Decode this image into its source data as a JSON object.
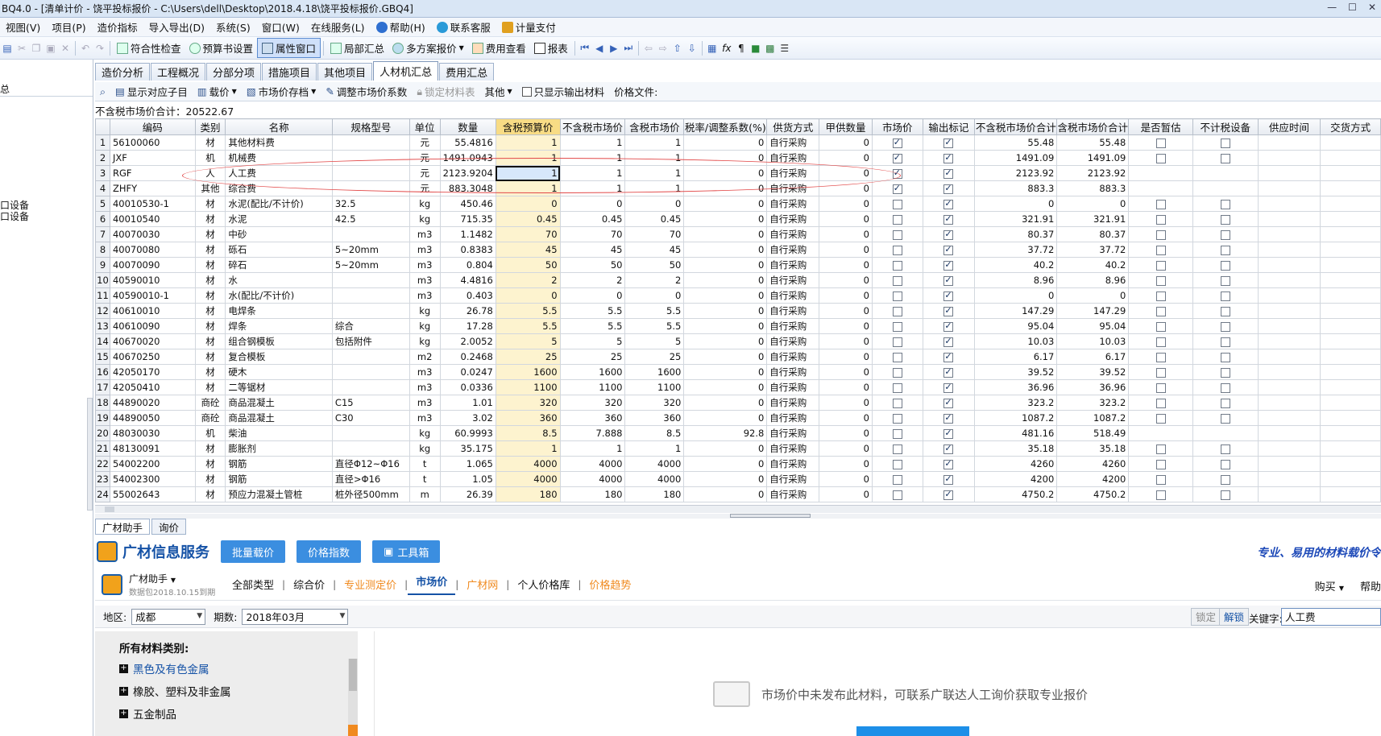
{
  "window": {
    "title": "BQ4.0 - [清单计价 - 饶平投标报价 - C:\\Users\\dell\\Desktop\\2018.4.18\\饶平投标报价.GBQ4]"
  },
  "menu": [
    "视图(V)",
    "项目(P)",
    "造价指标",
    "导入导出(D)",
    "系统(S)",
    "窗口(W)",
    "在线服务(L)",
    "帮助(H)",
    "联系客服",
    "计量支付"
  ],
  "toolbar": {
    "check": "符合性检查",
    "budget_settings": "预算书设置",
    "property_window": "属性窗口",
    "partial_summary": "局部汇总",
    "multi_plan": "多方案报价",
    "fee_view": "费用查看",
    "report": "报表"
  },
  "tabs": [
    "造价分析",
    "工程概况",
    "分部分项",
    "措施项目",
    "其他项目",
    "人材机汇总",
    "费用汇总"
  ],
  "subbar": {
    "show_sub": "显示对应子目",
    "load_price": "载价",
    "market_save": "市场价存档",
    "adjust_coef": "调整市场价系数",
    "lock_table": "锁定材料表",
    "other": "其他",
    "only_output": "只显示输出材料",
    "price_file": "价格文件:"
  },
  "summary": "不含税市场价合计：20522.67",
  "left_panel": {
    "head": "总",
    "item1": "口设备",
    "item2": "口设备"
  },
  "grid": {
    "headers": [
      "",
      "编码",
      "类别",
      "名称",
      "规格型号",
      "单位",
      "数量",
      "含税预算价",
      "不含税市场价",
      "含税市场价",
      "税率/调整系数(%)",
      "供货方式",
      "甲供数量",
      "市场价",
      "输出标记",
      "不含税市场价合计",
      "含税市场价合计",
      "是否暂估",
      "不计税设备",
      "供应时间",
      "交货方式"
    ],
    "rows": [
      {
        "n": "1",
        "code": "56100060",
        "type": "材",
        "name": "其他材料费",
        "spec": "",
        "unit": "元",
        "qty": "55.4816",
        "bp": "1",
        "mp": "1",
        "tmp": "1",
        "tax": "0",
        "supply": "自行采购",
        "jq": "0",
        "mk": true,
        "out": true,
        "sum1": "55.48",
        "sum2": "55.48",
        "est": false,
        "ntax": false
      },
      {
        "n": "2",
        "code": "JXF",
        "type": "机",
        "name": "机械费",
        "spec": "",
        "unit": "元",
        "qty": "1491.0943",
        "bp": "1",
        "mp": "1",
        "tmp": "1",
        "tax": "0",
        "supply": "自行采购",
        "jq": "0",
        "mk": true,
        "out": true,
        "sum1": "1491.09",
        "sum2": "1491.09",
        "est": false,
        "ntax": false
      },
      {
        "n": "3",
        "code": "RGF",
        "type": "人",
        "name": "人工费",
        "spec": "",
        "unit": "元",
        "qty": "2123.9204",
        "bp": "1",
        "mp": "1",
        "tmp": "1",
        "tax": "0",
        "supply": "自行采购",
        "jq": "0",
        "mk": true,
        "out": true,
        "sum1": "2123.92",
        "sum2": "2123.92",
        "est": null,
        "ntax": null
      },
      {
        "n": "4",
        "code": "ZHFY",
        "type": "其他",
        "name": "综合费",
        "spec": "",
        "unit": "元",
        "qty": "883.3048",
        "bp": "1",
        "mp": "1",
        "tmp": "1",
        "tax": "0",
        "supply": "自行采购",
        "jq": "0",
        "mk": true,
        "out": true,
        "sum1": "883.3",
        "sum2": "883.3",
        "est": null,
        "ntax": null
      },
      {
        "n": "5",
        "code": "40010530-1",
        "type": "材",
        "name": "水泥(配比/不计价)",
        "spec": "32.5",
        "unit": "kg",
        "qty": "450.46",
        "bp": "0",
        "mp": "0",
        "tmp": "0",
        "tax": "0",
        "supply": "自行采购",
        "jq": "0",
        "mk": false,
        "out": true,
        "sum1": "0",
        "sum2": "0",
        "est": false,
        "ntax": false
      },
      {
        "n": "6",
        "code": "40010540",
        "type": "材",
        "name": "水泥",
        "spec": "42.5",
        "unit": "kg",
        "qty": "715.35",
        "bp": "0.45",
        "mp": "0.45",
        "tmp": "0.45",
        "tax": "0",
        "supply": "自行采购",
        "jq": "0",
        "mk": false,
        "out": true,
        "sum1": "321.91",
        "sum2": "321.91",
        "est": false,
        "ntax": false
      },
      {
        "n": "7",
        "code": "40070030",
        "type": "材",
        "name": "中砂",
        "spec": "",
        "unit": "m3",
        "qty": "1.1482",
        "bp": "70",
        "mp": "70",
        "tmp": "70",
        "tax": "0",
        "supply": "自行采购",
        "jq": "0",
        "mk": false,
        "out": true,
        "sum1": "80.37",
        "sum2": "80.37",
        "est": false,
        "ntax": false
      },
      {
        "n": "8",
        "code": "40070080",
        "type": "材",
        "name": "砾石",
        "spec": "5~20mm",
        "unit": "m3",
        "qty": "0.8383",
        "bp": "45",
        "mp": "45",
        "tmp": "45",
        "tax": "0",
        "supply": "自行采购",
        "jq": "0",
        "mk": false,
        "out": true,
        "sum1": "37.72",
        "sum2": "37.72",
        "est": false,
        "ntax": false
      },
      {
        "n": "9",
        "code": "40070090",
        "type": "材",
        "name": "碎石",
        "spec": "5~20mm",
        "unit": "m3",
        "qty": "0.804",
        "bp": "50",
        "mp": "50",
        "tmp": "50",
        "tax": "0",
        "supply": "自行采购",
        "jq": "0",
        "mk": false,
        "out": true,
        "sum1": "40.2",
        "sum2": "40.2",
        "est": false,
        "ntax": false
      },
      {
        "n": "10",
        "code": "40590010",
        "type": "材",
        "name": "水",
        "spec": "",
        "unit": "m3",
        "qty": "4.4816",
        "bp": "2",
        "mp": "2",
        "tmp": "2",
        "tax": "0",
        "supply": "自行采购",
        "jq": "0",
        "mk": false,
        "out": true,
        "sum1": "8.96",
        "sum2": "8.96",
        "est": false,
        "ntax": false
      },
      {
        "n": "11",
        "code": "40590010-1",
        "type": "材",
        "name": "水(配比/不计价)",
        "spec": "",
        "unit": "m3",
        "qty": "0.403",
        "bp": "0",
        "mp": "0",
        "tmp": "0",
        "tax": "0",
        "supply": "自行采购",
        "jq": "0",
        "mk": false,
        "out": true,
        "sum1": "0",
        "sum2": "0",
        "est": false,
        "ntax": false
      },
      {
        "n": "12",
        "code": "40610010",
        "type": "材",
        "name": "电焊条",
        "spec": "",
        "unit": "kg",
        "qty": "26.78",
        "bp": "5.5",
        "mp": "5.5",
        "tmp": "5.5",
        "tax": "0",
        "supply": "自行采购",
        "jq": "0",
        "mk": false,
        "out": true,
        "sum1": "147.29",
        "sum2": "147.29",
        "est": false,
        "ntax": false
      },
      {
        "n": "13",
        "code": "40610090",
        "type": "材",
        "name": "焊条",
        "spec": "综合",
        "unit": "kg",
        "qty": "17.28",
        "bp": "5.5",
        "mp": "5.5",
        "tmp": "5.5",
        "tax": "0",
        "supply": "自行采购",
        "jq": "0",
        "mk": false,
        "out": true,
        "sum1": "95.04",
        "sum2": "95.04",
        "est": false,
        "ntax": false
      },
      {
        "n": "14",
        "code": "40670020",
        "type": "材",
        "name": "组合钢模板",
        "spec": "包括附件",
        "unit": "kg",
        "qty": "2.0052",
        "bp": "5",
        "mp": "5",
        "tmp": "5",
        "tax": "0",
        "supply": "自行采购",
        "jq": "0",
        "mk": false,
        "out": true,
        "sum1": "10.03",
        "sum2": "10.03",
        "est": false,
        "ntax": false
      },
      {
        "n": "15",
        "code": "40670250",
        "type": "材",
        "name": "复合模板",
        "spec": "",
        "unit": "m2",
        "qty": "0.2468",
        "bp": "25",
        "mp": "25",
        "tmp": "25",
        "tax": "0",
        "supply": "自行采购",
        "jq": "0",
        "mk": false,
        "out": true,
        "sum1": "6.17",
        "sum2": "6.17",
        "est": false,
        "ntax": false
      },
      {
        "n": "16",
        "code": "42050170",
        "type": "材",
        "name": "硬木",
        "spec": "",
        "unit": "m3",
        "qty": "0.0247",
        "bp": "1600",
        "mp": "1600",
        "tmp": "1600",
        "tax": "0",
        "supply": "自行采购",
        "jq": "0",
        "mk": false,
        "out": true,
        "sum1": "39.52",
        "sum2": "39.52",
        "est": false,
        "ntax": false
      },
      {
        "n": "17",
        "code": "42050410",
        "type": "材",
        "name": "二等锯材",
        "spec": "",
        "unit": "m3",
        "qty": "0.0336",
        "bp": "1100",
        "mp": "1100",
        "tmp": "1100",
        "tax": "0",
        "supply": "自行采购",
        "jq": "0",
        "mk": false,
        "out": true,
        "sum1": "36.96",
        "sum2": "36.96",
        "est": false,
        "ntax": false
      },
      {
        "n": "18",
        "code": "44890020",
        "type": "商砼",
        "name": "商品混凝土",
        "spec": "C15",
        "unit": "m3",
        "qty": "1.01",
        "bp": "320",
        "mp": "320",
        "tmp": "320",
        "tax": "0",
        "supply": "自行采购",
        "jq": "0",
        "mk": false,
        "out": true,
        "sum1": "323.2",
        "sum2": "323.2",
        "est": false,
        "ntax": false
      },
      {
        "n": "19",
        "code": "44890050",
        "type": "商砼",
        "name": "商品混凝土",
        "spec": "C30",
        "unit": "m3",
        "qty": "3.02",
        "bp": "360",
        "mp": "360",
        "tmp": "360",
        "tax": "0",
        "supply": "自行采购",
        "jq": "0",
        "mk": false,
        "out": true,
        "sum1": "1087.2",
        "sum2": "1087.2",
        "est": false,
        "ntax": false
      },
      {
        "n": "20",
        "code": "48030030",
        "type": "机",
        "name": "柴油",
        "spec": "",
        "unit": "kg",
        "qty": "60.9993",
        "bp": "8.5",
        "mp": "7.888",
        "tmp": "8.5",
        "tax": "92.8",
        "supply": "自行采购",
        "jq": "0",
        "mk": false,
        "out": true,
        "sum1": "481.16",
        "sum2": "518.49",
        "est": null,
        "ntax": null
      },
      {
        "n": "21",
        "code": "48130091",
        "type": "材",
        "name": "膨胀剂",
        "spec": "",
        "unit": "kg",
        "qty": "35.175",
        "bp": "1",
        "mp": "1",
        "tmp": "1",
        "tax": "0",
        "supply": "自行采购",
        "jq": "0",
        "mk": false,
        "out": true,
        "sum1": "35.18",
        "sum2": "35.18",
        "est": false,
        "ntax": false
      },
      {
        "n": "22",
        "code": "54002200",
        "type": "材",
        "name": "钢筋",
        "spec": "直径Φ12~Φ16",
        "unit": "t",
        "qty": "1.065",
        "bp": "4000",
        "mp": "4000",
        "tmp": "4000",
        "tax": "0",
        "supply": "自行采购",
        "jq": "0",
        "mk": false,
        "out": true,
        "sum1": "4260",
        "sum2": "4260",
        "est": false,
        "ntax": false
      },
      {
        "n": "23",
        "code": "54002300",
        "type": "材",
        "name": "钢筋",
        "spec": "直径>Φ16",
        "unit": "t",
        "qty": "1.05",
        "bp": "4000",
        "mp": "4000",
        "tmp": "4000",
        "tax": "0",
        "supply": "自行采购",
        "jq": "0",
        "mk": false,
        "out": true,
        "sum1": "4200",
        "sum2": "4200",
        "est": false,
        "ntax": false
      },
      {
        "n": "24",
        "code": "55002643",
        "type": "材",
        "name": "预应力混凝土管桩",
        "spec": "桩外径500mm",
        "unit": "m",
        "qty": "26.39",
        "bp": "180",
        "mp": "180",
        "tmp": "180",
        "tax": "0",
        "supply": "自行采购",
        "jq": "0",
        "mk": false,
        "out": true,
        "sum1": "4750.2",
        "sum2": "4750.2",
        "est": false,
        "ntax": false
      }
    ]
  },
  "bottom": {
    "tabs": [
      "广材助手",
      "询价"
    ],
    "service_title": "广材信息服务",
    "btn_batch": "批量载价",
    "btn_index": "价格指数",
    "btn_tools": "工具箱",
    "slogan": "专业、易用的材料载价令",
    "assist_name": "广材助手",
    "assist_expire": "数据包2018.10.15到期",
    "nav": [
      "全部类型",
      "综合价",
      "专业测定价",
      "市场价",
      "广材网",
      "个人价格库",
      "价格趋势"
    ],
    "buy": "购买",
    "help": "帮助",
    "region_label": "地区:",
    "region_value": "成都",
    "period_label": "期数:",
    "period_value": "2018年03月",
    "lock": "锁定",
    "unlock": "解锁",
    "keyword_label": "关键字:",
    "keyword_value": "人工费",
    "cat_head": "所有材料类别:",
    "categories": [
      "黑色及有色金属",
      "橡胶、塑料及非金属",
      "五金制品"
    ],
    "nodata": "市场价中未发布此材料，可联系广联达人工询价获取专业报价"
  }
}
